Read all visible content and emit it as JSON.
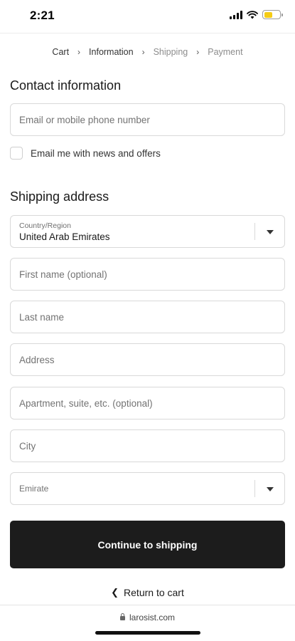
{
  "status_bar": {
    "time": "2:21",
    "battery_level": 0.55,
    "colors": {
      "battery": "#f5cc16"
    }
  },
  "breadcrumb": {
    "items": [
      {
        "label": "Cart",
        "state": "link"
      },
      {
        "label": "Information",
        "state": "current"
      },
      {
        "label": "Shipping",
        "state": "upcoming"
      },
      {
        "label": "Payment",
        "state": "upcoming"
      }
    ],
    "separator": ">"
  },
  "contact": {
    "title": "Contact information",
    "email_placeholder": "Email or mobile phone number",
    "email_value": "",
    "newsletter_label": "Email me with news and offers",
    "newsletter_checked": false
  },
  "shipping": {
    "title": "Shipping address",
    "country_label": "Country/Region",
    "country_value": "United Arab Emirates",
    "first_name_placeholder": "First name (optional)",
    "last_name_placeholder": "Last name",
    "address_placeholder": "Address",
    "apartment_placeholder": "Apartment, suite, etc. (optional)",
    "city_placeholder": "City",
    "emirate_placeholder": "Emirate"
  },
  "actions": {
    "continue_label": "Continue to shipping",
    "return_label": "Return to cart",
    "return_icon": "chevron-left-icon"
  },
  "browser": {
    "url": "larosist.com",
    "lock_icon": "lock-icon"
  },
  "colors": {
    "button_bg": "#1c1c1c",
    "button_text": "#ffffff",
    "border": "#d9d9d9"
  }
}
